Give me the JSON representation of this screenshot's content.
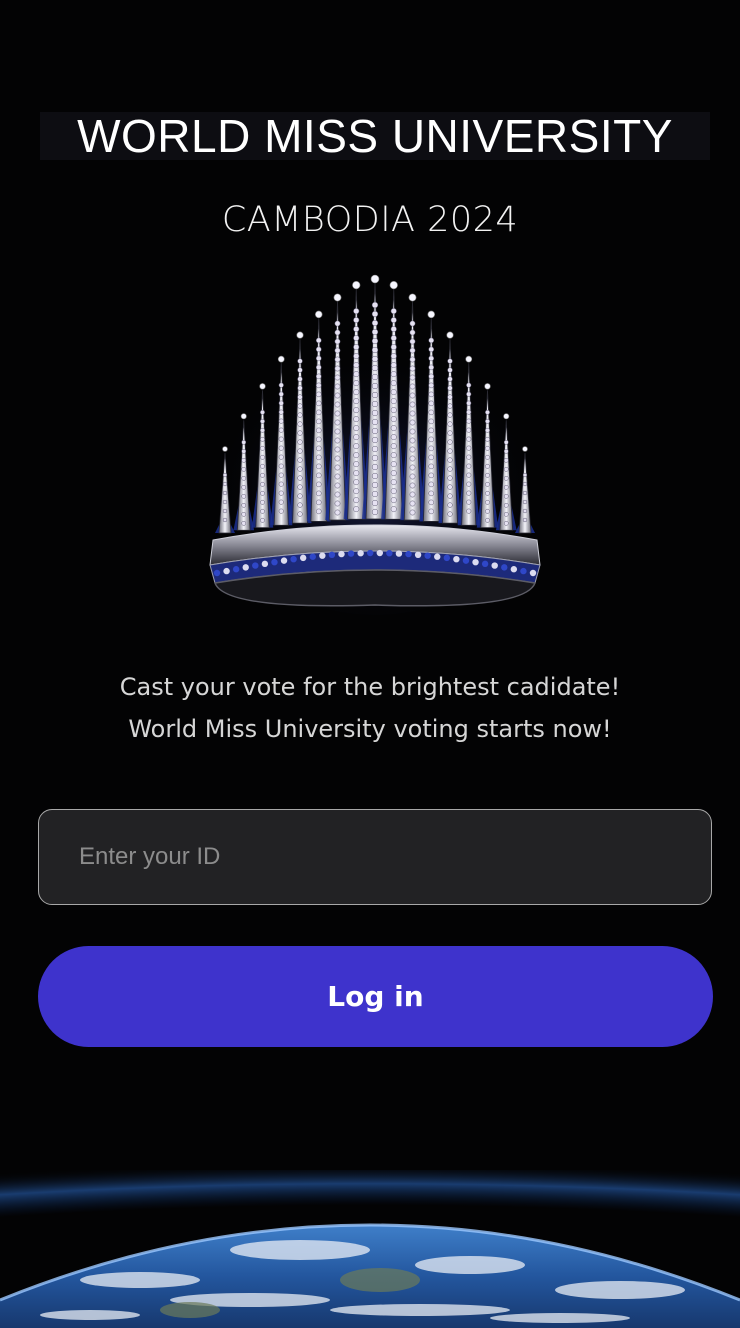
{
  "header": {
    "title": "WORLD MISS UNIVERSITY",
    "subtitle": "CAMBODIA 2024"
  },
  "tagline": {
    "line1": "Cast your vote for the brightest cadidate!",
    "line2": "World Miss University voting starts now!"
  },
  "login": {
    "id_placeholder": "Enter your ID",
    "id_value": "",
    "button_label": "Log in"
  },
  "colors": {
    "background": "#030304",
    "button": "#3e33cc",
    "input_bg": "#222224",
    "input_border": "#a8a8a8"
  },
  "icons": {
    "crown": "crown-image",
    "earth": "earth-horizon-image"
  }
}
